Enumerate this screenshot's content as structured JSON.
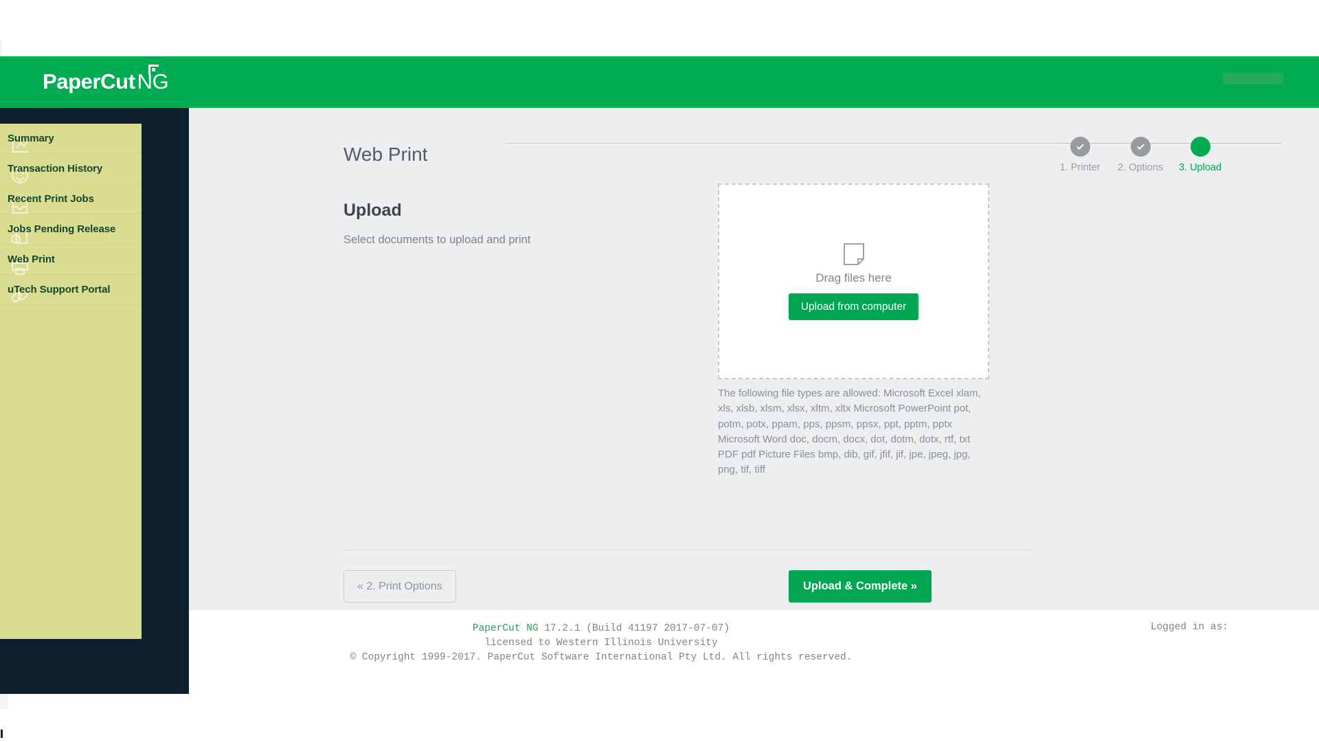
{
  "brand": {
    "name_bold": "Paper",
    "name_rest": "Cut",
    "suffix": "NG",
    "header_color": "#00ac51"
  },
  "sidebar": {
    "items": [
      {
        "label": "Summary",
        "icon": "chart-summary-icon"
      },
      {
        "label": "Transaction History",
        "icon": "transaction-exchange-icon"
      },
      {
        "label": "Recent Print Jobs",
        "icon": "inbox-tray-icon"
      },
      {
        "label": "Jobs Pending Release",
        "icon": "document-clock-icon"
      },
      {
        "label": "Web Print",
        "icon": "printer-icon"
      },
      {
        "label": "uTech Support Portal",
        "icon": "link-chain-icon"
      }
    ]
  },
  "main": {
    "page_title": "Web Print",
    "steps": [
      {
        "label": "1. Printer",
        "state": "done"
      },
      {
        "label": "2. Options",
        "state": "done"
      },
      {
        "label": "3. Upload",
        "state": "active"
      }
    ],
    "upload": {
      "heading": "Upload",
      "subtitle": "Select documents to upload and print",
      "dropzone_text": "Drag files here",
      "dropzone_icon": "document-page-icon",
      "upload_button": "Upload from computer",
      "filetypes": "The following file types are allowed: Microsoft Excel xlam, xls, xlsb, xlsm, xlsx, xltm, xltx Microsoft PowerPoint pot, potm, potx, ppam, pps, ppsm, ppsx, ppt, pptm, pptx Microsoft Word doc, docm, docx, dot, dotm, dotx, rtf, txt PDF pdf Picture Files bmp, dib, gif, jfif, jif, jpe, jpeg, jpg, png, tif, tiff"
    },
    "back_button": "« 2. Print Options",
    "complete_button": "Upload & Complete »"
  },
  "footer": {
    "app_name": "PaperCut NG",
    "version": " 17.2.1 (Build 41197 2017-07-07)",
    "license": "licensed to Western Illinois University",
    "copyright": "© Copyright 1999-2017. PaperCut Software International Pty Ltd. All rights reserved.",
    "logged_in_as": "Logged in as:"
  },
  "colors": {
    "brand_green": "#00ac51",
    "button_green": "#00a651",
    "sidebar_dark": "#101f2e",
    "nav_highlight": "#dadd90",
    "content_bg": "#eceef0"
  }
}
